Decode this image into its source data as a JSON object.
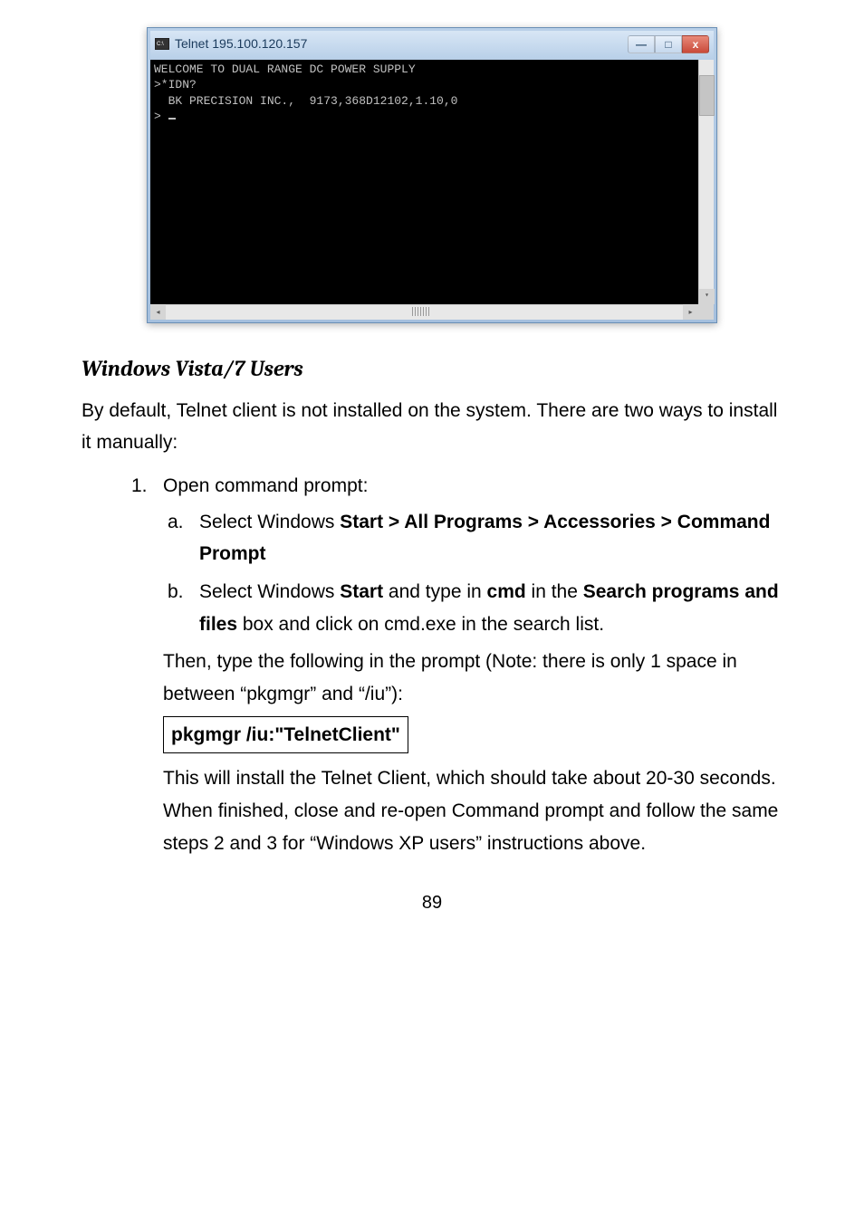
{
  "window": {
    "title": "Telnet 195.100.120.157",
    "console_lines": "WELCOME TO DUAL RANGE DC POWER SUPPLY\n>*IDN?\n  BK PRECISION INC.,  9173,368D12102,1.10,0\n> "
  },
  "controls": {
    "min": "—",
    "max": "□",
    "close": "x"
  },
  "scroll": {
    "up": "▴",
    "down": "▾",
    "left": "◂",
    "right": "▸"
  },
  "heading": "Windows Vista/7 Users",
  "intro": "By default, Telnet client is not installed on the system.  There are two ways to install it manually:",
  "step1": {
    "marker": "1.",
    "text": "Open command prompt:"
  },
  "step_a": {
    "marker": "a.",
    "prefix": "Select Windows ",
    "bold": "Start > All Programs > Accessories > Command Prompt"
  },
  "step_b": {
    "marker": "b.",
    "prefix": "Select Windows ",
    "b1": "Start",
    "mid1": " and type in ",
    "b2": "cmd",
    "mid2": " in the ",
    "b3": "Search programs and files",
    "tail": " box and click on cmd.exe in the search list."
  },
  "then_text": "Then, type the following in the prompt (Note: there is only 1 space in between “pkgmgr” and “/iu”):",
  "code_cmd": "pkgmgr /iu:\"TelnetClient\"",
  "after_text": "This will install the Telnet Client, which should take about 20-30 seconds.  When finished, close and re-open Command prompt and follow the same steps 2 and 3 for “Windows XP users” instructions above.",
  "page_number": "89"
}
